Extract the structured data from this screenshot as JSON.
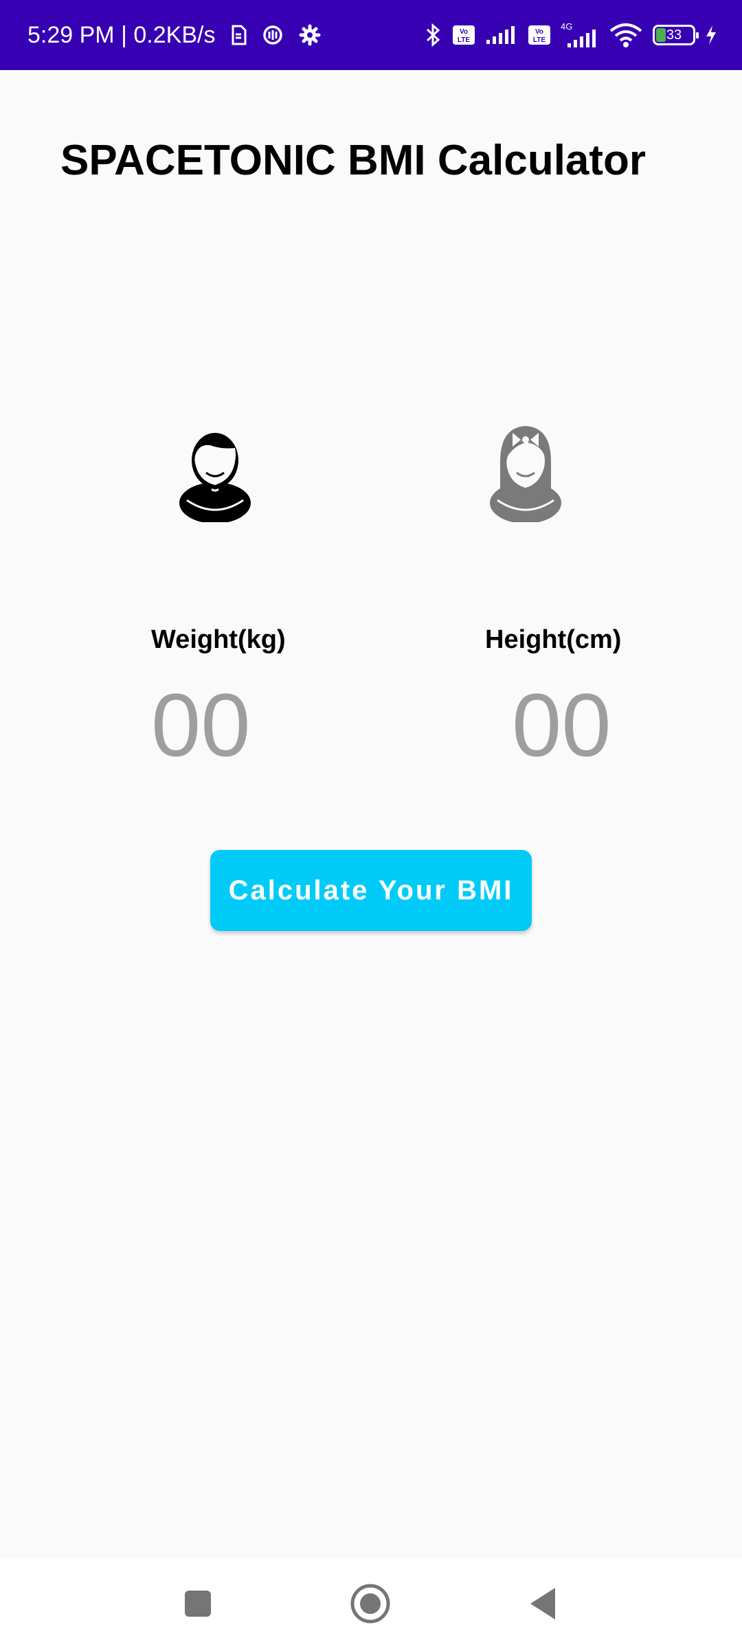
{
  "status_bar": {
    "time": "5:29 PM",
    "separator": "|",
    "network_speed": "0.2KB/s",
    "network_type": "4G",
    "battery_level": "33",
    "left_icons": [
      "sim-icon",
      "sync-icon",
      "gear-icon"
    ],
    "right_icons": [
      "bluetooth-icon",
      "volte-icon",
      "signal-icon",
      "volte-icon",
      "signal-4g-icon",
      "wifi-icon",
      "battery-icon",
      "charging-icon"
    ],
    "background_color": "#3700b3"
  },
  "header": {
    "title": "SPACETONIC BMI Calculator"
  },
  "gender": {
    "male_icon": "male-avatar-icon",
    "female_icon": "female-avatar-icon",
    "male_color": "#000000",
    "female_color": "#7a7a7a"
  },
  "inputs": {
    "weight": {
      "label": "Weight(kg)",
      "placeholder": "00",
      "value": ""
    },
    "height": {
      "label": "Height(cm)",
      "placeholder": "00",
      "value": ""
    }
  },
  "actions": {
    "calculate_label": "Calculate Your BMI",
    "calculate_color": "#00cbf8"
  },
  "nav_bar": {
    "items": [
      "recent-apps-icon",
      "home-icon",
      "back-icon"
    ]
  }
}
